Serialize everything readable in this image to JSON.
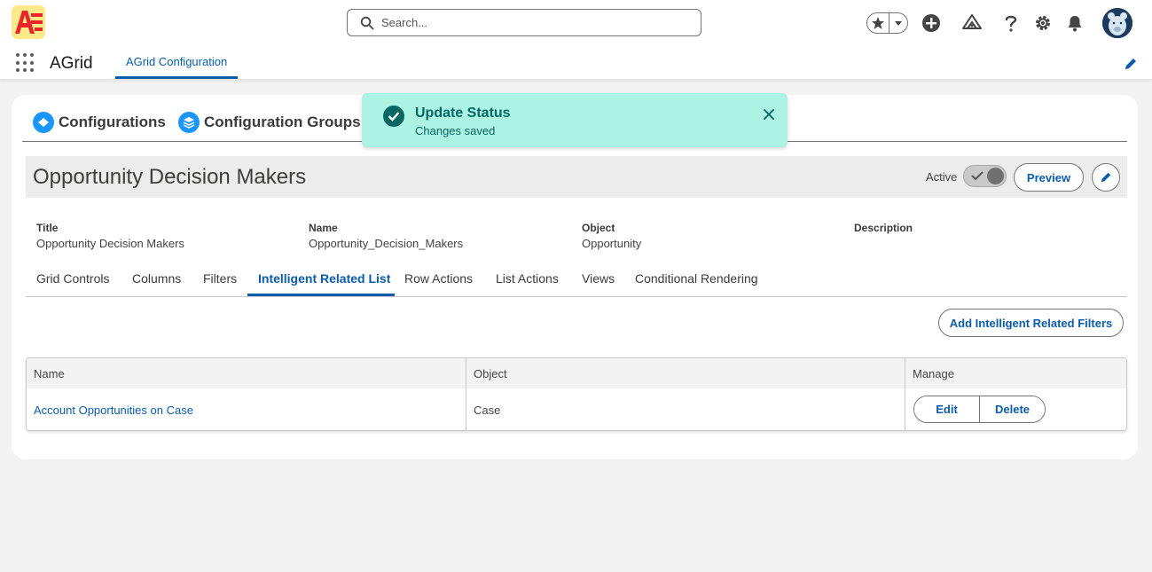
{
  "header": {
    "search_placeholder": "Search...",
    "app_name": "AGrid",
    "nav_tab": "AGrid Configuration"
  },
  "top_tabs": [
    {
      "label": "Configurations"
    },
    {
      "label": "Configuration Groups"
    }
  ],
  "record": {
    "title": "Opportunity Decision Makers",
    "status_label": "Active",
    "preview_label": "Preview",
    "active": true
  },
  "fields": [
    {
      "label": "Title",
      "value": "Opportunity Decision Makers"
    },
    {
      "label": "Name",
      "value": "Opportunity_Decision_Makers"
    },
    {
      "label": "Object",
      "value": "Opportunity"
    },
    {
      "label": "Description",
      "value": ""
    }
  ],
  "sub_tabs": [
    {
      "label": "Grid Controls"
    },
    {
      "label": "Columns"
    },
    {
      "label": "Filters"
    },
    {
      "label": "Intelligent Related List"
    },
    {
      "label": "Row Actions"
    },
    {
      "label": "List Actions"
    },
    {
      "label": "Views"
    },
    {
      "label": "Conditional Rendering"
    }
  ],
  "add_button_label": "Add Intelligent Related Filters",
  "grid": {
    "columns": [
      "Name",
      "Object",
      "Manage"
    ],
    "rows": [
      {
        "name": "Account Opportunities on Case",
        "object": "Case",
        "edit_label": "Edit",
        "delete_label": "Delete"
      }
    ]
  },
  "toast": {
    "title": "Update Status",
    "message": "Changes saved"
  },
  "colors": {
    "brand": "#0b5cab",
    "toast_bg": "#acf3e4",
    "toast_text": "#056764",
    "tab_icon": "#1b96ff"
  }
}
